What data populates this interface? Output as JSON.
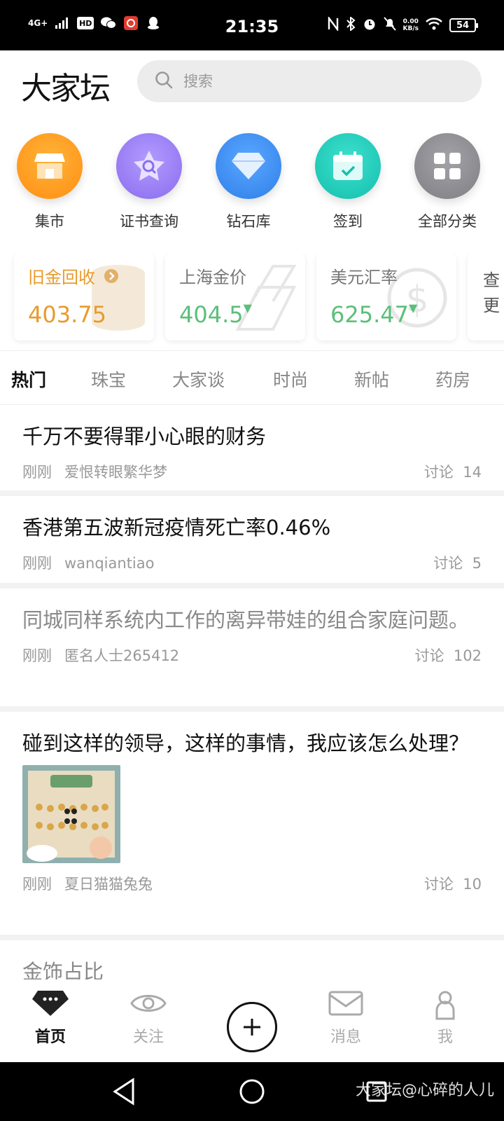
{
  "status_bar": {
    "network": "4G+",
    "hd": "HD",
    "time": "21:35",
    "speed_value": "0.00",
    "speed_unit": "KB/s",
    "battery": "54"
  },
  "header": {
    "logo": "大家坛",
    "search_placeholder": "搜索"
  },
  "shortcuts": [
    {
      "label": "集市",
      "icon": "shop-icon",
      "color": "#ff9a1f"
    },
    {
      "label": "证书查询",
      "icon": "certificate-search-icon",
      "color": "#9a7cf2"
    },
    {
      "label": "钻石库",
      "icon": "diamond-icon",
      "color": "#3f8ff2"
    },
    {
      "label": "签到",
      "icon": "calendar-checkin-icon",
      "color": "#1dc9b8"
    },
    {
      "label": "全部分类",
      "icon": "grid-icon",
      "color": "#8f8f95"
    }
  ],
  "price_cards": [
    {
      "title": "旧金回收",
      "value": "403.75",
      "color": "#e89b2c"
    },
    {
      "title": "上海金价",
      "value": "404.5",
      "color": "#5bbf7a"
    },
    {
      "title": "美元汇率",
      "value": "625.47",
      "color": "#5bbf7a"
    },
    {
      "title": "查",
      "title2": "更"
    }
  ],
  "tabs": [
    "热门",
    "珠宝",
    "大家谈",
    "时尚",
    "新帖",
    "药房"
  ],
  "posts": [
    {
      "title": "千万不要得罪小心眼的财务",
      "time": "刚刚",
      "author": "爱恨转眼繁华梦",
      "discuss_label": "讨论",
      "count": "14"
    },
    {
      "title": "香港第五波新冠疫情死亡率0.46%",
      "time": "刚刚",
      "author": "wanqiantiao",
      "discuss_label": "讨论",
      "count": "5"
    },
    {
      "title": "同城同样系统内工作的离异带娃的组合家庭问题。",
      "time": "刚刚",
      "author": "匿名人士265412",
      "discuss_label": "讨论",
      "count": "102"
    },
    {
      "title": "碰到这样的领导，这样的事情，我应该怎么处理？",
      "time": "刚刚",
      "author": "夏日猫猫兔兔",
      "discuss_label": "讨论",
      "count": "10"
    },
    {
      "title": "金饰占比"
    }
  ],
  "bottom_nav": {
    "home": "首页",
    "follow": "关注",
    "messages": "消息",
    "me": "我"
  },
  "watermark": "大家坛@心碎的人儿"
}
